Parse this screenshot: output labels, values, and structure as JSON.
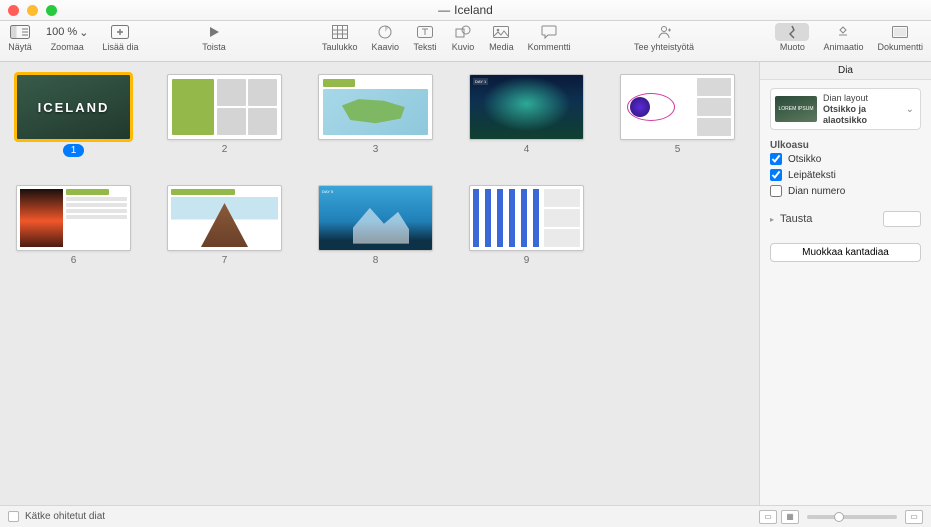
{
  "window": {
    "title": "Iceland",
    "edited_marker": "—"
  },
  "toolbar": {
    "view_label": "Näytä",
    "zoom_label": "Zoomaa",
    "zoom_value": "100 %",
    "add_slide_label": "Lisää dia",
    "play_label": "Toista",
    "table_label": "Taulukko",
    "chart_label": "Kaavio",
    "text_label": "Teksti",
    "shape_label": "Kuvio",
    "media_label": "Media",
    "comment_label": "Kommentti",
    "collaborate_label": "Tee yhteistyötä",
    "format_label": "Muoto",
    "animate_label": "Animaatio",
    "document_label": "Dokumentti"
  },
  "slides": [
    {
      "num": "1",
      "title": "ICELAND",
      "selected": true
    },
    {
      "num": "2",
      "title": "",
      "selected": false
    },
    {
      "num": "3",
      "title": "",
      "selected": false
    },
    {
      "num": "4",
      "title": "",
      "selected": false
    },
    {
      "num": "5",
      "title": "",
      "selected": false
    },
    {
      "num": "6",
      "title": "",
      "selected": false
    },
    {
      "num": "7",
      "title": "",
      "selected": false
    },
    {
      "num": "8",
      "title": "",
      "selected": false
    },
    {
      "num": "9",
      "title": "",
      "selected": false
    }
  ],
  "inspector": {
    "tab_label": "Dia",
    "layout_caption": "Dian layout",
    "layout_name": "Otsikko ja alaotsikko",
    "layout_preview_text": "LOREM IPSUM",
    "appearance_title": "Ulkoasu",
    "chk_title": "Otsikko",
    "chk_body": "Leipäteksti",
    "chk_slidenum": "Dian numero",
    "background_label": "Tausta",
    "edit_master_label": "Muokkaa kantadiaa"
  },
  "statusbar": {
    "hide_skipped_label": "Kätke ohitetut diat"
  }
}
